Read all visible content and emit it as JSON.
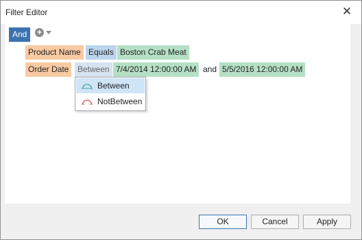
{
  "window": {
    "title": "Filter Editor",
    "close_glyph": "✕"
  },
  "group": {
    "operator_label": "And",
    "add_icon": "plus-circle-icon"
  },
  "conditions": [
    {
      "field": "Product Name",
      "operator": "Equals",
      "value": "Boston Crab Meat"
    },
    {
      "field": "Order Date",
      "operator": "Between",
      "value1": "7/4/2014 12:00:00 AM",
      "joiner": "and",
      "value2": "5/5/2016 12:00:00 AM"
    }
  ],
  "operator_menu": {
    "items": [
      {
        "label": "Between",
        "icon": "between-icon",
        "selected": true
      },
      {
        "label": "NotBetween",
        "icon": "not-between-icon",
        "selected": false
      }
    ]
  },
  "buttons": {
    "ok": "OK",
    "cancel": "Cancel",
    "apply": "Apply"
  },
  "colors": {
    "group_operator": "#3d72b0",
    "field": "#f8caa2",
    "operator": "#bcd5ec",
    "value": "#b5e0c6",
    "between_icon": "#4aa3a0",
    "not_between_icon": "#d9534f"
  }
}
